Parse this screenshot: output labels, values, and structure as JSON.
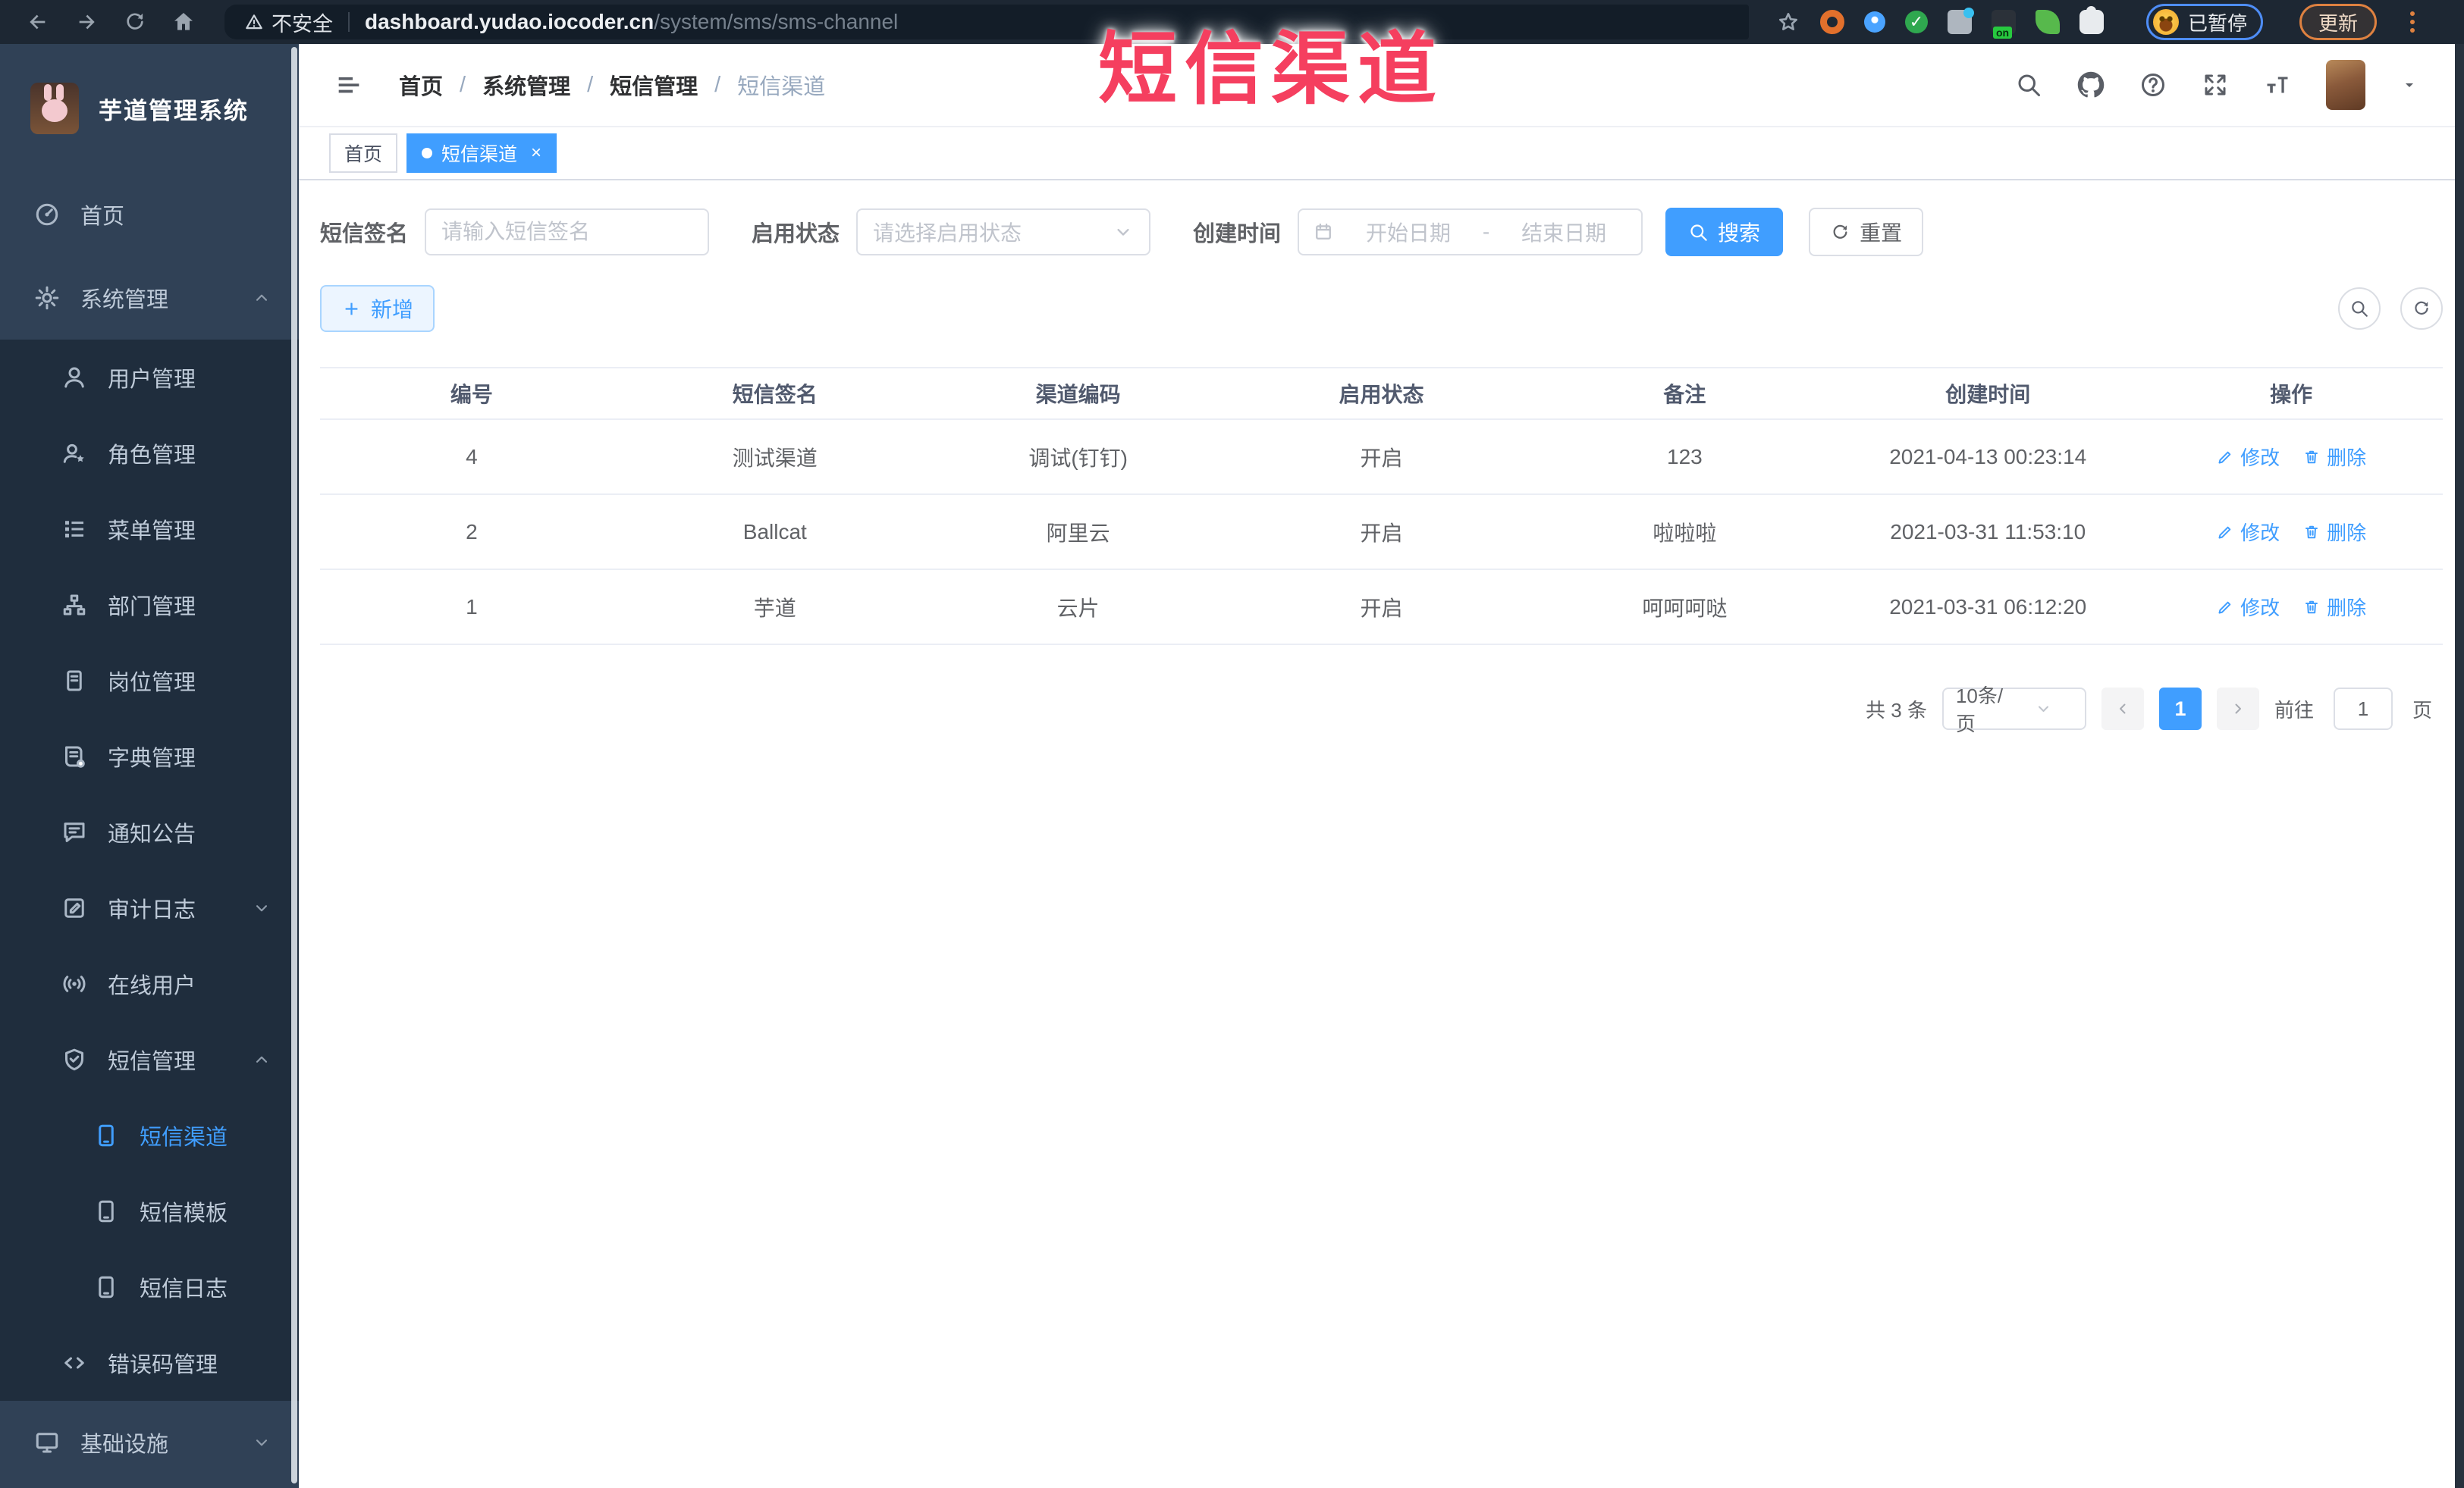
{
  "overlay": {
    "title": "短信渠道",
    "color": "#f53f5f"
  },
  "browser": {
    "nav_icons": [
      "back-arrow",
      "forward-arrow",
      "reload",
      "home"
    ],
    "security_warning": "不安全",
    "url": {
      "domain": "dashboard.yudao.iocoder.cn",
      "path": "/system/sms/sms-channel"
    },
    "extension_icons": [
      "bookmark-star",
      "orange-ring",
      "blue-pin",
      "green-check",
      "grid-blue-dot",
      "green-on-badge",
      "green-leaf",
      "puzzle-piece"
    ],
    "profile": {
      "paused_label": "已暂停"
    },
    "update_label": "更新"
  },
  "sidebar": {
    "logo_title": "芋道管理系统",
    "items": [
      {
        "label": "首页",
        "icon": "dashboard",
        "depth": 0
      },
      {
        "label": "系统管理",
        "icon": "gear",
        "depth": 0,
        "expanded": true
      },
      {
        "label": "用户管理",
        "icon": "user",
        "depth": 1
      },
      {
        "label": "角色管理",
        "icon": "role",
        "depth": 1
      },
      {
        "label": "菜单管理",
        "icon": "menu-list",
        "depth": 1
      },
      {
        "label": "部门管理",
        "icon": "org-tree",
        "depth": 1
      },
      {
        "label": "岗位管理",
        "icon": "post-badge",
        "depth": 1
      },
      {
        "label": "字典管理",
        "icon": "dictionary",
        "depth": 1
      },
      {
        "label": "通知公告",
        "icon": "announcement",
        "depth": 1
      },
      {
        "label": "审计日志",
        "icon": "audit-log",
        "depth": 1,
        "expanded": false
      },
      {
        "label": "在线用户",
        "icon": "online-user",
        "depth": 1
      },
      {
        "label": "短信管理",
        "icon": "sms-shield",
        "depth": 1,
        "expanded": true
      },
      {
        "label": "短信渠道",
        "icon": "phone",
        "depth": 2,
        "active": true
      },
      {
        "label": "短信模板",
        "icon": "phone",
        "depth": 2
      },
      {
        "label": "短信日志",
        "icon": "phone",
        "depth": 2
      },
      {
        "label": "错误码管理",
        "icon": "code",
        "depth": 1
      },
      {
        "label": "基础设施",
        "icon": "monitor",
        "depth": 0,
        "expanded": false
      }
    ]
  },
  "header": {
    "breadcrumb": [
      "首页",
      "系统管理",
      "短信管理",
      "短信渠道"
    ],
    "breadcrumb_separator": "/",
    "action_icons": [
      "search",
      "github",
      "help",
      "fullscreen",
      "font-size",
      "caret-down"
    ]
  },
  "tabs": [
    {
      "label": "首页",
      "active": false
    },
    {
      "label": "短信渠道",
      "active": true,
      "close": "×"
    }
  ],
  "filters": {
    "sign_label": "短信签名",
    "sign_placeholder": "请输入短信签名",
    "status_label": "启用状态",
    "status_placeholder": "请选择启用状态",
    "time_label": "创建时间",
    "date_start_placeholder": "开始日期",
    "date_separator": "-",
    "date_end_placeholder": "结束日期",
    "search_label": "搜索",
    "reset_label": "重置"
  },
  "toolbar": {
    "add_label": "新增",
    "icons": [
      "search-toggle",
      "refresh"
    ]
  },
  "table": {
    "columns": [
      "编号",
      "短信签名",
      "渠道编码",
      "启用状态",
      "备注",
      "创建时间",
      "操作"
    ],
    "edit_label": "修改",
    "delete_label": "删除",
    "rows": [
      {
        "id": "4",
        "sign": "测试渠道",
        "code": "调试(钉钉)",
        "status": "开启",
        "remark": "123",
        "created": "2021-04-13 00:23:14"
      },
      {
        "id": "2",
        "sign": "Ballcat",
        "code": "阿里云",
        "status": "开启",
        "remark": "啦啦啦",
        "created": "2021-03-31 11:53:10"
      },
      {
        "id": "1",
        "sign": "芋道",
        "code": "云片",
        "status": "开启",
        "remark": "呵呵呵哒",
        "created": "2021-03-31 06:12:20"
      }
    ]
  },
  "pagination": {
    "total_text": "共 3 条",
    "page_size": "10条/页",
    "current_page": "1",
    "goto_label": "前往",
    "goto_value": "1",
    "unit_label": "页"
  },
  "accent_colors": {
    "primary": "#409EFF",
    "sidebar": "#304156",
    "submenu": "#1f2d3d"
  }
}
